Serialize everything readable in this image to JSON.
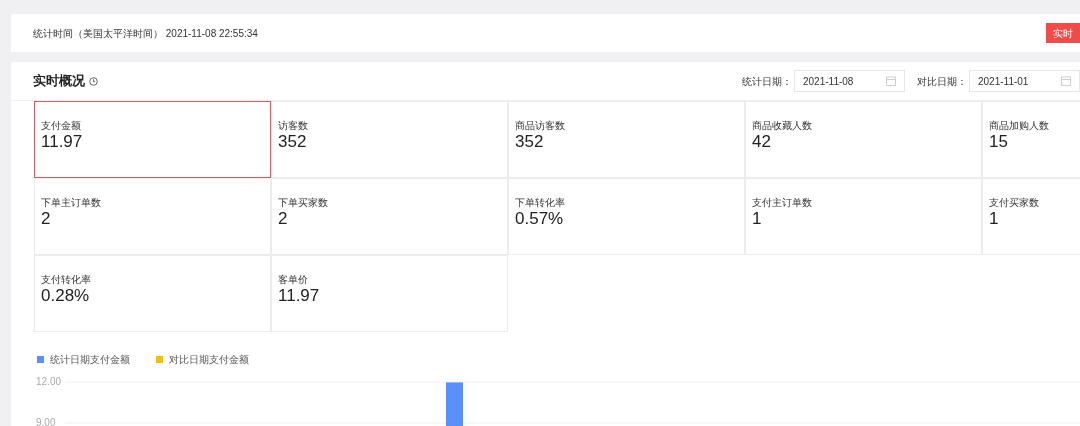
{
  "stats_time": "统计时间（美国太平洋时间） 2021-11-08 22:55:34",
  "realtime_button": "实时",
  "overview": {
    "title": "实时概况",
    "date_filters": [
      {
        "label": "统计日期：",
        "value": "2021-11-08"
      },
      {
        "label": "对比日期：",
        "value": "2021-11-01"
      }
    ],
    "metrics": [
      {
        "label": "支付金额",
        "value": "11.97",
        "selected": true
      },
      {
        "label": "访客数",
        "value": "352",
        "selected": false
      },
      {
        "label": "商品访客数",
        "value": "352",
        "selected": false
      },
      {
        "label": "商品收藏人数",
        "value": "42",
        "selected": false
      },
      {
        "label": "商品加购人数",
        "value": "15",
        "selected": false
      },
      {
        "label": "下单主订单数",
        "value": "2",
        "selected": false
      },
      {
        "label": "下单买家数",
        "value": "2",
        "selected": false
      },
      {
        "label": "下单转化率",
        "value": "0.57%",
        "selected": false
      },
      {
        "label": "支付主订单数",
        "value": "1",
        "selected": false
      },
      {
        "label": "支付买家数",
        "value": "1",
        "selected": false
      },
      {
        "label": "支付转化率",
        "value": "0.28%",
        "selected": false
      },
      {
        "label": "客单价",
        "value": "11.97",
        "selected": false
      }
    ],
    "chart_data": {
      "type": "bar",
      "ylim": [
        8.5,
        12
      ],
      "yticks": [
        {
          "value": 9,
          "label": "9.00"
        },
        {
          "value": 12,
          "label": "12.00"
        }
      ],
      "series": [
        {
          "name": "统计日期支付金额",
          "color": "#5b8ff9",
          "values": [
            null,
            null,
            null,
            null,
            null,
            null,
            null,
            null,
            null,
            11.97,
            null,
            null,
            null,
            null,
            null,
            null,
            null,
            null,
            null,
            null,
            null,
            null,
            null,
            null
          ]
        },
        {
          "name": "对比日期支付金额",
          "color": "#f6bd16",
          "values": [
            null,
            null,
            null,
            null,
            null,
            null,
            null,
            null,
            null,
            null,
            null,
            null,
            null,
            null,
            null,
            null,
            null,
            null,
            null,
            null,
            null,
            null,
            null,
            null
          ]
        }
      ]
    }
  }
}
